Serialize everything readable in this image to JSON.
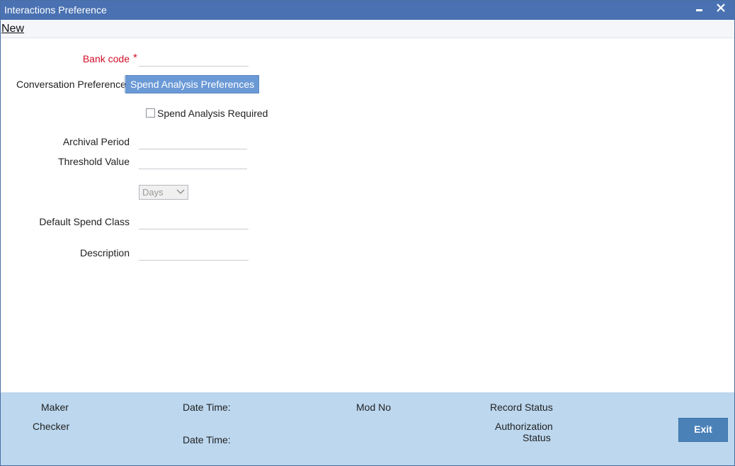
{
  "window": {
    "title": "Interactions Preference",
    "minimize_icon": "minimize-icon",
    "close_icon": "close-icon"
  },
  "menu": {
    "new_label": "New"
  },
  "form": {
    "bank_code": {
      "label": "Bank code",
      "required_marker": "*",
      "value": ""
    },
    "tabs": [
      {
        "label": "Conversation Preferences",
        "active": false
      },
      {
        "label": "Spend Analysis Preferences",
        "active": true
      }
    ],
    "spend_analysis_required": {
      "label": "Spend Analysis Required",
      "checked": false
    },
    "archival_period": {
      "label": "Archival Period",
      "value": ""
    },
    "threshold_value": {
      "label": "Threshold Value",
      "value": ""
    },
    "period_unit": {
      "selected": "Days",
      "icon": "chevron-down-icon"
    },
    "default_spend_class": {
      "label": "Default Spend Class",
      "value": ""
    },
    "description": {
      "label": "Description",
      "value": ""
    }
  },
  "footer": {
    "maker_label": "Maker",
    "checker_label": "Checker",
    "date_time_label_1": "Date Time:",
    "date_time_label_2": "Date Time:",
    "mod_no_label": "Mod No",
    "record_status_label": "Record Status",
    "authorization_label": "Authorization",
    "status_label": "Status",
    "exit_label": "Exit"
  },
  "colors": {
    "titlebar": "#4a72b2",
    "active_tab": "#6a99d6",
    "required": "#d0102a",
    "footer": "#bcd7ee",
    "exit_button": "#4a82b8"
  }
}
